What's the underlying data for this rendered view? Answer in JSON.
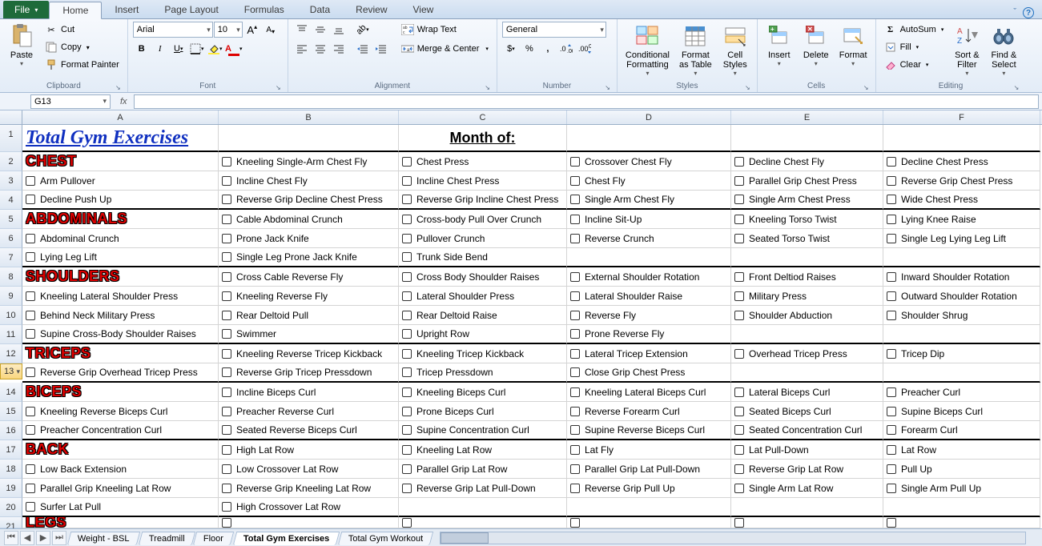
{
  "ribbon": {
    "file": "File",
    "tabs": [
      "Home",
      "Insert",
      "Page Layout",
      "Formulas",
      "Data",
      "Review",
      "View"
    ],
    "activeTab": "Home",
    "clipboard": {
      "paste": "Paste",
      "cut": "Cut",
      "copy": "Copy",
      "painter": "Format Painter",
      "label": "Clipboard"
    },
    "font": {
      "name": "Arial",
      "size": "10",
      "label": "Font"
    },
    "alignment": {
      "wrap": "Wrap Text",
      "merge": "Merge & Center",
      "label": "Alignment"
    },
    "number": {
      "format": "General",
      "label": "Number"
    },
    "styles": {
      "cond": "Conditional\nFormatting",
      "table": "Format\nas Table",
      "cell": "Cell\nStyles",
      "label": "Styles"
    },
    "cells": {
      "insert": "Insert",
      "delete": "Delete",
      "format": "Format",
      "label": "Cells"
    },
    "editing": {
      "sum": "AutoSum",
      "fill": "Fill",
      "clear": "Clear",
      "sort": "Sort &\nFilter",
      "find": "Find &\nSelect",
      "label": "Editing"
    }
  },
  "namebox": "G13",
  "columns": [
    "A",
    "B",
    "C",
    "D",
    "E",
    "F"
  ],
  "sheetTabs": [
    "Weight - BSL",
    "Treadmill",
    "Floor",
    "Total Gym Exercises",
    "Total Gym Workout"
  ],
  "activeSheet": "Total Gym Exercises",
  "grid": {
    "title": "Total Gym Exercises",
    "month": "Month of:",
    "rows": [
      {
        "r": 2,
        "bb": false,
        "cells": [
          {
            "t": "CHEST",
            "hd": true
          },
          {
            "t": "Kneeling Single-Arm Chest Fly",
            "cb": true
          },
          {
            "t": "Chest Press",
            "cb": true
          },
          {
            "t": "Crossover Chest Fly",
            "cb": true
          },
          {
            "t": "Decline Chest Fly",
            "cb": true
          },
          {
            "t": "Decline Chest Press",
            "cb": true
          }
        ]
      },
      {
        "r": 3,
        "bb": false,
        "cells": [
          {
            "t": "Arm Pullover",
            "cb": true
          },
          {
            "t": "Incline Chest Fly",
            "cb": true
          },
          {
            "t": "Incline Chest Press",
            "cb": true
          },
          {
            "t": "Chest Fly",
            "cb": true
          },
          {
            "t": "Parallel Grip Chest Press",
            "cb": true
          },
          {
            "t": "Reverse Grip Chest Press",
            "cb": true
          }
        ]
      },
      {
        "r": 4,
        "bb": true,
        "cells": [
          {
            "t": "Decline Push Up",
            "cb": true
          },
          {
            "t": "Reverse Grip Decline Chest Press",
            "cb": true
          },
          {
            "t": "Reverse Grip Incline Chest Press",
            "cb": true
          },
          {
            "t": "Single Arm Chest Fly",
            "cb": true
          },
          {
            "t": "Single Arm Chest Press",
            "cb": true
          },
          {
            "t": "Wide Chest Press",
            "cb": true
          }
        ]
      },
      {
        "r": 5,
        "bb": false,
        "cells": [
          {
            "t": "ABDOMINALS",
            "hd": true
          },
          {
            "t": "Cable Abdominal Crunch",
            "cb": true
          },
          {
            "t": "Cross-body Pull Over Crunch",
            "cb": true
          },
          {
            "t": "Incline Sit-Up",
            "cb": true
          },
          {
            "t": "Kneeling Torso Twist",
            "cb": true
          },
          {
            "t": "Lying Knee Raise",
            "cb": true
          }
        ]
      },
      {
        "r": 6,
        "bb": false,
        "cells": [
          {
            "t": "Abdominal Crunch",
            "cb": true
          },
          {
            "t": "Prone Jack Knife",
            "cb": true
          },
          {
            "t": "Pullover Crunch",
            "cb": true
          },
          {
            "t": "Reverse Crunch",
            "cb": true
          },
          {
            "t": "Seated Torso Twist",
            "cb": true
          },
          {
            "t": "Single Leg Lying Leg Lift",
            "cb": true
          }
        ]
      },
      {
        "r": 7,
        "bb": true,
        "cells": [
          {
            "t": "Lying Leg Lift",
            "cb": true
          },
          {
            "t": "Single Leg Prone Jack Knife",
            "cb": true
          },
          {
            "t": "Trunk Side Bend",
            "cb": true
          },
          {
            "t": ""
          },
          {
            "t": ""
          },
          {
            "t": ""
          }
        ]
      },
      {
        "r": 8,
        "bb": false,
        "cells": [
          {
            "t": "SHOULDERS",
            "hd": true
          },
          {
            "t": "Cross Cable Reverse Fly",
            "cb": true
          },
          {
            "t": "Cross Body Shoulder Raises",
            "cb": true
          },
          {
            "t": "External Shoulder Rotation",
            "cb": true
          },
          {
            "t": "Front Deltiod Raises",
            "cb": true
          },
          {
            "t": "Inward Shoulder Rotation",
            "cb": true
          }
        ]
      },
      {
        "r": 9,
        "bb": false,
        "cells": [
          {
            "t": "Kneeling Lateral Shoulder Press",
            "cb": true
          },
          {
            "t": "Kneeling Reverse Fly",
            "cb": true
          },
          {
            "t": "Lateral Shoulder Press",
            "cb": true
          },
          {
            "t": "Lateral Shoulder Raise",
            "cb": true
          },
          {
            "t": "Military Press",
            "cb": true
          },
          {
            "t": "Outward Shoulder Rotation",
            "cb": true
          }
        ]
      },
      {
        "r": 10,
        "bb": false,
        "cells": [
          {
            "t": "Behind Neck Military Press",
            "cb": true
          },
          {
            "t": "Rear Deltoid Pull",
            "cb": true
          },
          {
            "t": "Rear Deltoid Raise",
            "cb": true
          },
          {
            "t": "Reverse Fly",
            "cb": true
          },
          {
            "t": "Shoulder Abduction",
            "cb": true
          },
          {
            "t": "Shoulder Shrug",
            "cb": true
          }
        ]
      },
      {
        "r": 11,
        "bb": true,
        "cells": [
          {
            "t": "Supine Cross-Body Shoulder Raises",
            "cb": true
          },
          {
            "t": "Swimmer",
            "cb": true
          },
          {
            "t": "Upright Row",
            "cb": true
          },
          {
            "t": "Prone Reverse Fly",
            "cb": true
          },
          {
            "t": ""
          },
          {
            "t": ""
          }
        ]
      },
      {
        "r": 12,
        "bb": false,
        "cells": [
          {
            "t": "TRICEPS",
            "hd": true
          },
          {
            "t": "Kneeling Reverse Tricep Kickback",
            "cb": true
          },
          {
            "t": "Kneeling Tricep Kickback",
            "cb": true
          },
          {
            "t": "Lateral Tricep Extension",
            "cb": true
          },
          {
            "t": "Overhead Tricep Press",
            "cb": true
          },
          {
            "t": "Tricep Dip",
            "cb": true
          }
        ]
      },
      {
        "r": 13,
        "bb": true,
        "sel": true,
        "cells": [
          {
            "t": "Reverse Grip Overhead Tricep Press",
            "cb": true
          },
          {
            "t": "Reverse Grip Tricep Pressdown",
            "cb": true
          },
          {
            "t": "Tricep Pressdown",
            "cb": true
          },
          {
            "t": "Close Grip Chest Press",
            "cb": true
          },
          {
            "t": ""
          },
          {
            "t": ""
          }
        ]
      },
      {
        "r": 14,
        "bb": false,
        "cells": [
          {
            "t": "BICEPS",
            "hd": true
          },
          {
            "t": "Incline Biceps Curl",
            "cb": true
          },
          {
            "t": "Kneeling Biceps Curl",
            "cb": true
          },
          {
            "t": "Kneeling Lateral Biceps Curl",
            "cb": true
          },
          {
            "t": "Lateral Biceps Curl",
            "cb": true
          },
          {
            "t": "Preacher Curl",
            "cb": true
          }
        ]
      },
      {
        "r": 15,
        "bb": false,
        "cells": [
          {
            "t": "Kneeling Reverse Biceps Curl",
            "cb": true
          },
          {
            "t": "Preacher Reverse Curl",
            "cb": true
          },
          {
            "t": "Prone Biceps Curl",
            "cb": true
          },
          {
            "t": "Reverse Forearm Curl",
            "cb": true
          },
          {
            "t": "Seated Biceps Curl",
            "cb": true
          },
          {
            "t": "Supine Biceps Curl",
            "cb": true
          }
        ]
      },
      {
        "r": 16,
        "bb": true,
        "cells": [
          {
            "t": "Preacher Concentration Curl",
            "cb": true
          },
          {
            "t": "Seated Reverse Biceps Curl",
            "cb": true
          },
          {
            "t": "Supine Concentration Curl",
            "cb": true
          },
          {
            "t": "Supine Reverse Biceps Curl",
            "cb": true
          },
          {
            "t": "Seated Concentration Curl",
            "cb": true
          },
          {
            "t": "Forearm Curl",
            "cb": true
          }
        ]
      },
      {
        "r": 17,
        "bb": false,
        "cells": [
          {
            "t": "BACK",
            "hd": true
          },
          {
            "t": "High Lat Row",
            "cb": true
          },
          {
            "t": "Kneeling Lat Row",
            "cb": true
          },
          {
            "t": "Lat Fly",
            "cb": true
          },
          {
            "t": "Lat Pull-Down",
            "cb": true
          },
          {
            "t": "Lat Row",
            "cb": true
          }
        ]
      },
      {
        "r": 18,
        "bb": false,
        "cells": [
          {
            "t": "Low Back Extension",
            "cb": true
          },
          {
            "t": "Low Crossover Lat Row",
            "cb": true
          },
          {
            "t": "Parallel Grip Lat Row",
            "cb": true
          },
          {
            "t": "Parallel Grip Lat Pull-Down",
            "cb": true
          },
          {
            "t": "Reverse Grip Lat Row",
            "cb": true
          },
          {
            "t": "Pull Up",
            "cb": true
          }
        ]
      },
      {
        "r": 19,
        "bb": false,
        "cells": [
          {
            "t": "Parallel Grip Kneeling Lat Row",
            "cb": true
          },
          {
            "t": "Reverse Grip Kneeling Lat Row",
            "cb": true
          },
          {
            "t": "Reverse Grip Lat Pull-Down",
            "cb": true
          },
          {
            "t": "Reverse Grip Pull Up",
            "cb": true
          },
          {
            "t": "Single Arm Lat Row",
            "cb": true
          },
          {
            "t": "Single Arm Pull Up",
            "cb": true
          }
        ]
      },
      {
        "r": 20,
        "bb": true,
        "cells": [
          {
            "t": "Surfer Lat Pull",
            "cb": true
          },
          {
            "t": "High Crossover Lat Row",
            "cb": true
          },
          {
            "t": ""
          },
          {
            "t": ""
          },
          {
            "t": ""
          },
          {
            "t": ""
          }
        ]
      },
      {
        "r": 21,
        "bb": false,
        "cells": [
          {
            "t": "LEGS",
            "hd": true,
            "cut": true
          },
          {
            "t": "",
            "cb": true,
            "cut": true
          },
          {
            "t": "",
            "cb": true,
            "cut": true
          },
          {
            "t": "",
            "cb": true,
            "cut": true
          },
          {
            "t": "",
            "cb": true,
            "cut": true
          },
          {
            "t": "",
            "cb": true,
            "cut": true
          }
        ]
      }
    ]
  }
}
